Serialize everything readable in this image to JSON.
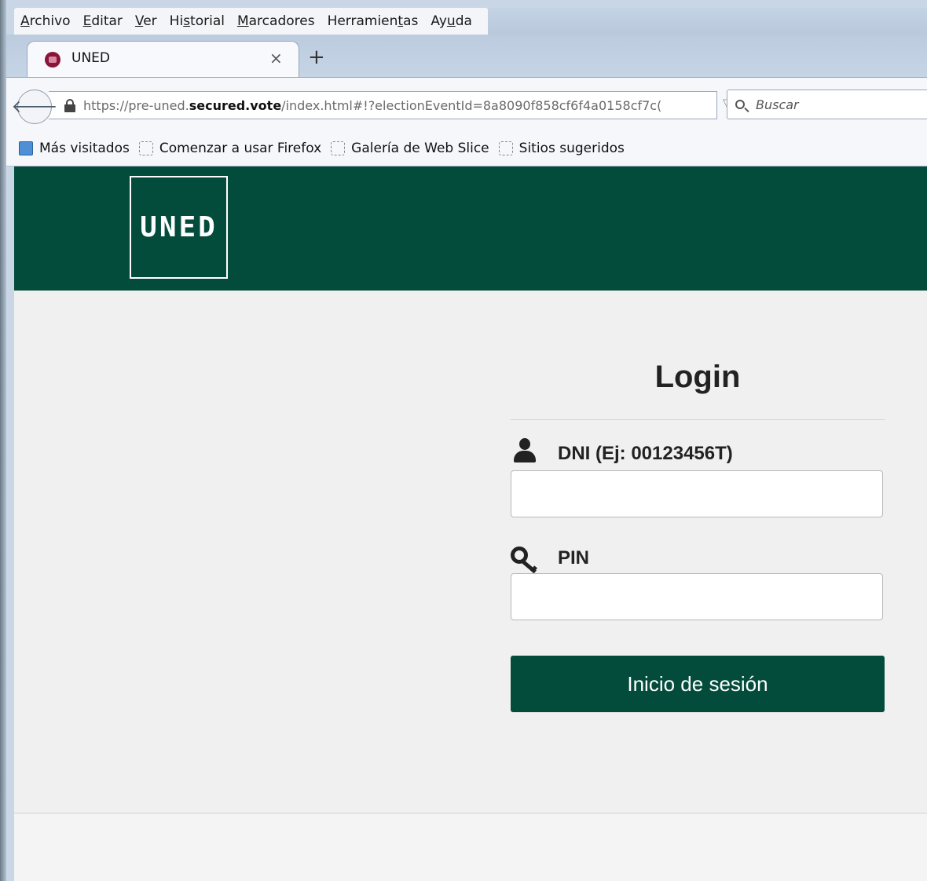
{
  "menu": {
    "items": [
      "Archivo",
      "Editar",
      "Ver",
      "Historial",
      "Marcadores",
      "Herramientas",
      "Ayuda"
    ],
    "accel": [
      "A",
      "E",
      "V",
      "s",
      "M",
      "t",
      "u"
    ]
  },
  "tab": {
    "title": "UNED",
    "close": "×",
    "new_tab": "+"
  },
  "address": {
    "prefix": "https://pre-uned.",
    "domain": "secured.vote",
    "suffix": "/index.html#!?electionEventId=8a8090f858cf6f4a0158cf7c(",
    "dropdown": "▽",
    "reload": "↻"
  },
  "search": {
    "placeholder": "Buscar"
  },
  "bookmarks": [
    "Más visitados",
    "Comenzar a usar Firefox",
    "Galería de Web Slice",
    "Sitios sugeridos"
  ],
  "header": {
    "logo": "UNED"
  },
  "login": {
    "title": "Login",
    "dni_label": "DNI (Ej: 00123456T)",
    "dni_value": "",
    "pin_label": "PIN",
    "pin_value": "",
    "submit_label": "Inicio de sesión"
  },
  "colors": {
    "brand": "#034c3c",
    "background": "#f0f0f0"
  }
}
